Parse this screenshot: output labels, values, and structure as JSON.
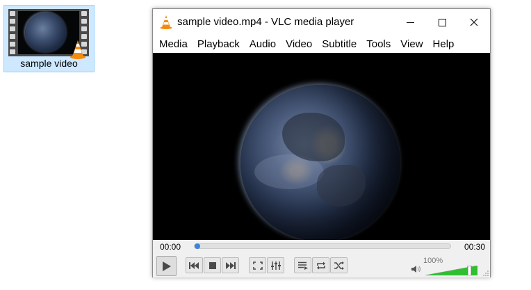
{
  "desktop": {
    "file_label": "sample video"
  },
  "window": {
    "title": "sample video.mp4 - VLC media player",
    "controls": {
      "minimize_icon": "minimize-icon",
      "maximize_icon": "maximize-icon",
      "close_icon": "close-icon"
    }
  },
  "menu": [
    {
      "label": "Media"
    },
    {
      "label": "Playback"
    },
    {
      "label": "Audio"
    },
    {
      "label": "Video"
    },
    {
      "label": "Subtitle"
    },
    {
      "label": "Tools"
    },
    {
      "label": "View"
    },
    {
      "label": "Help"
    }
  ],
  "player": {
    "current_time": "00:00",
    "total_time": "00:30",
    "progress": 0.0,
    "volume_label": "100%",
    "volume": 1.0
  },
  "colors": {
    "accent": "#3c85d6",
    "volume_green": "#2fbf2f",
    "vlc_orange": "#f58b0e"
  },
  "icons": {
    "play": "play-icon",
    "previous": "previous-icon",
    "stop": "stop-icon",
    "next": "next-icon",
    "fullscreen": "fullscreen-icon",
    "extended": "extended-settings-icon",
    "playlist": "playlist-icon",
    "loop": "loop-icon",
    "random": "shuffle-icon",
    "volume": "speaker-icon"
  }
}
